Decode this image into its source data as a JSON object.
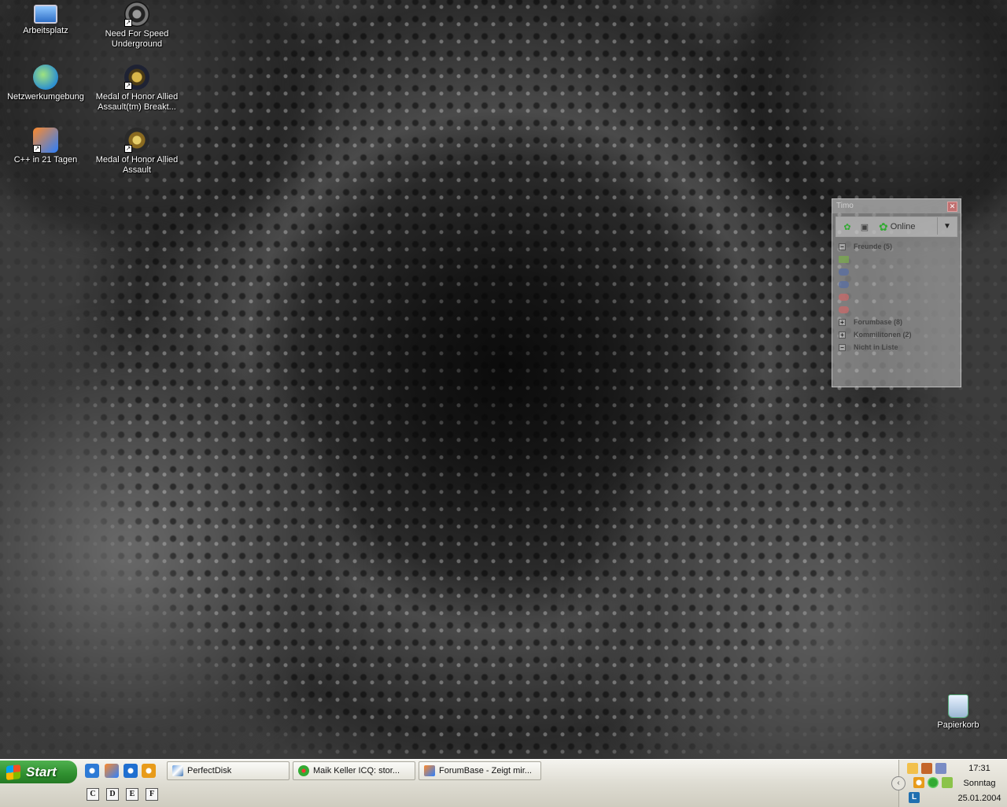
{
  "desktop": {
    "icons": [
      {
        "label": "Arbeitsplatz",
        "icon": "computer-icon"
      },
      {
        "label": "Need For Speed Underground",
        "icon": "nfs-icon"
      },
      {
        "label": "Netzwerkumgebung",
        "icon": "network-icon"
      },
      {
        "label": "Medal of Honor Allied Assault(tm) Breakt...",
        "icon": "moh-breakthrough-icon"
      },
      {
        "label": "C++ in 21 Tagen",
        "icon": "cpp-book-icon"
      },
      {
        "label": "Medal of Honor Allied Assault",
        "icon": "moh-icon"
      },
      {
        "label": "Papierkorb",
        "icon": "recycle-bin-icon"
      }
    ]
  },
  "icq": {
    "title": "Timo",
    "status": "Online",
    "groups": [
      {
        "label": "Freunde (5)",
        "expanded": true
      },
      {
        "label": "Forumbase (8)",
        "expanded": false
      },
      {
        "label": "Kommilitonen (2)",
        "expanded": false
      },
      {
        "label": "Nicht in Liste",
        "expanded": true
      }
    ],
    "contacts_count": 5
  },
  "taskbar": {
    "start_label": "Start",
    "quick_launch": [
      "ie-icon",
      "firefox-icon",
      "browser-icon",
      "icq-quick-icon"
    ],
    "drives": [
      "C",
      "D",
      "E",
      "F"
    ],
    "tasks": [
      {
        "label": "PerfectDisk",
        "icon": "perfectdisk-icon"
      },
      {
        "label": "Maik Keller ICQ: stor...",
        "icon": "icq-flower-icon"
      },
      {
        "label": "ForumBase - Zeigt mir...",
        "icon": "firefox-icon"
      }
    ],
    "clock": {
      "time": "17:31",
      "day": "Sonntag",
      "date": "25.01.2004"
    }
  },
  "colors": {
    "start_green": "#2f8f2f",
    "taskbar": "#dedcd2"
  }
}
